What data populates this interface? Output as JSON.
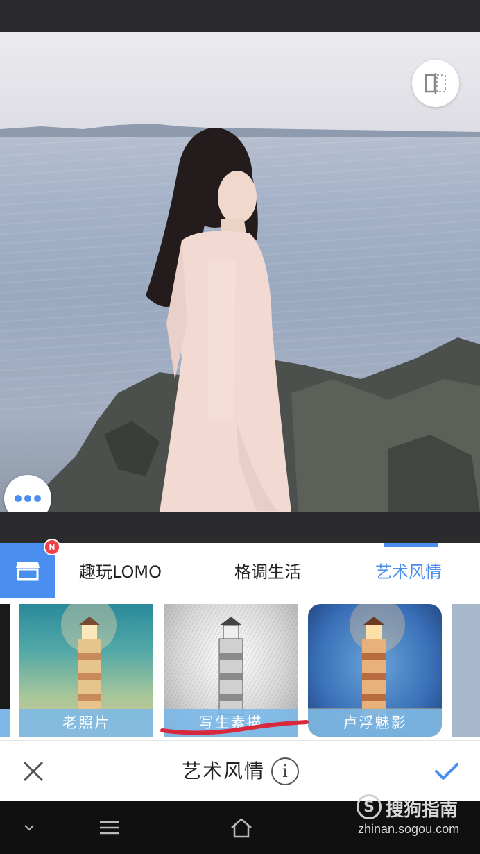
{
  "tabs": [
    {
      "label": "趣玩LOMO",
      "active": false
    },
    {
      "label": "格调生活",
      "active": false
    },
    {
      "label": "艺术风情",
      "active": true
    }
  ],
  "store": {
    "icon": "store-icon",
    "badge": "N"
  },
  "filters": [
    {
      "label": "老照片",
      "style": "vintage"
    },
    {
      "label": "写生素描",
      "style": "sketch"
    },
    {
      "label": "卢浮魅影",
      "style": "vignette"
    }
  ],
  "action_bar": {
    "title": "艺术风情",
    "info_symbol": "i"
  },
  "watermark": {
    "brand": "搜狗指南",
    "logo_letter": "S",
    "url": "zhinan.sogou.com"
  },
  "colors": {
    "accent": "#4a8ef0",
    "badge": "#f04048",
    "label_bg": "#78b9eb"
  }
}
